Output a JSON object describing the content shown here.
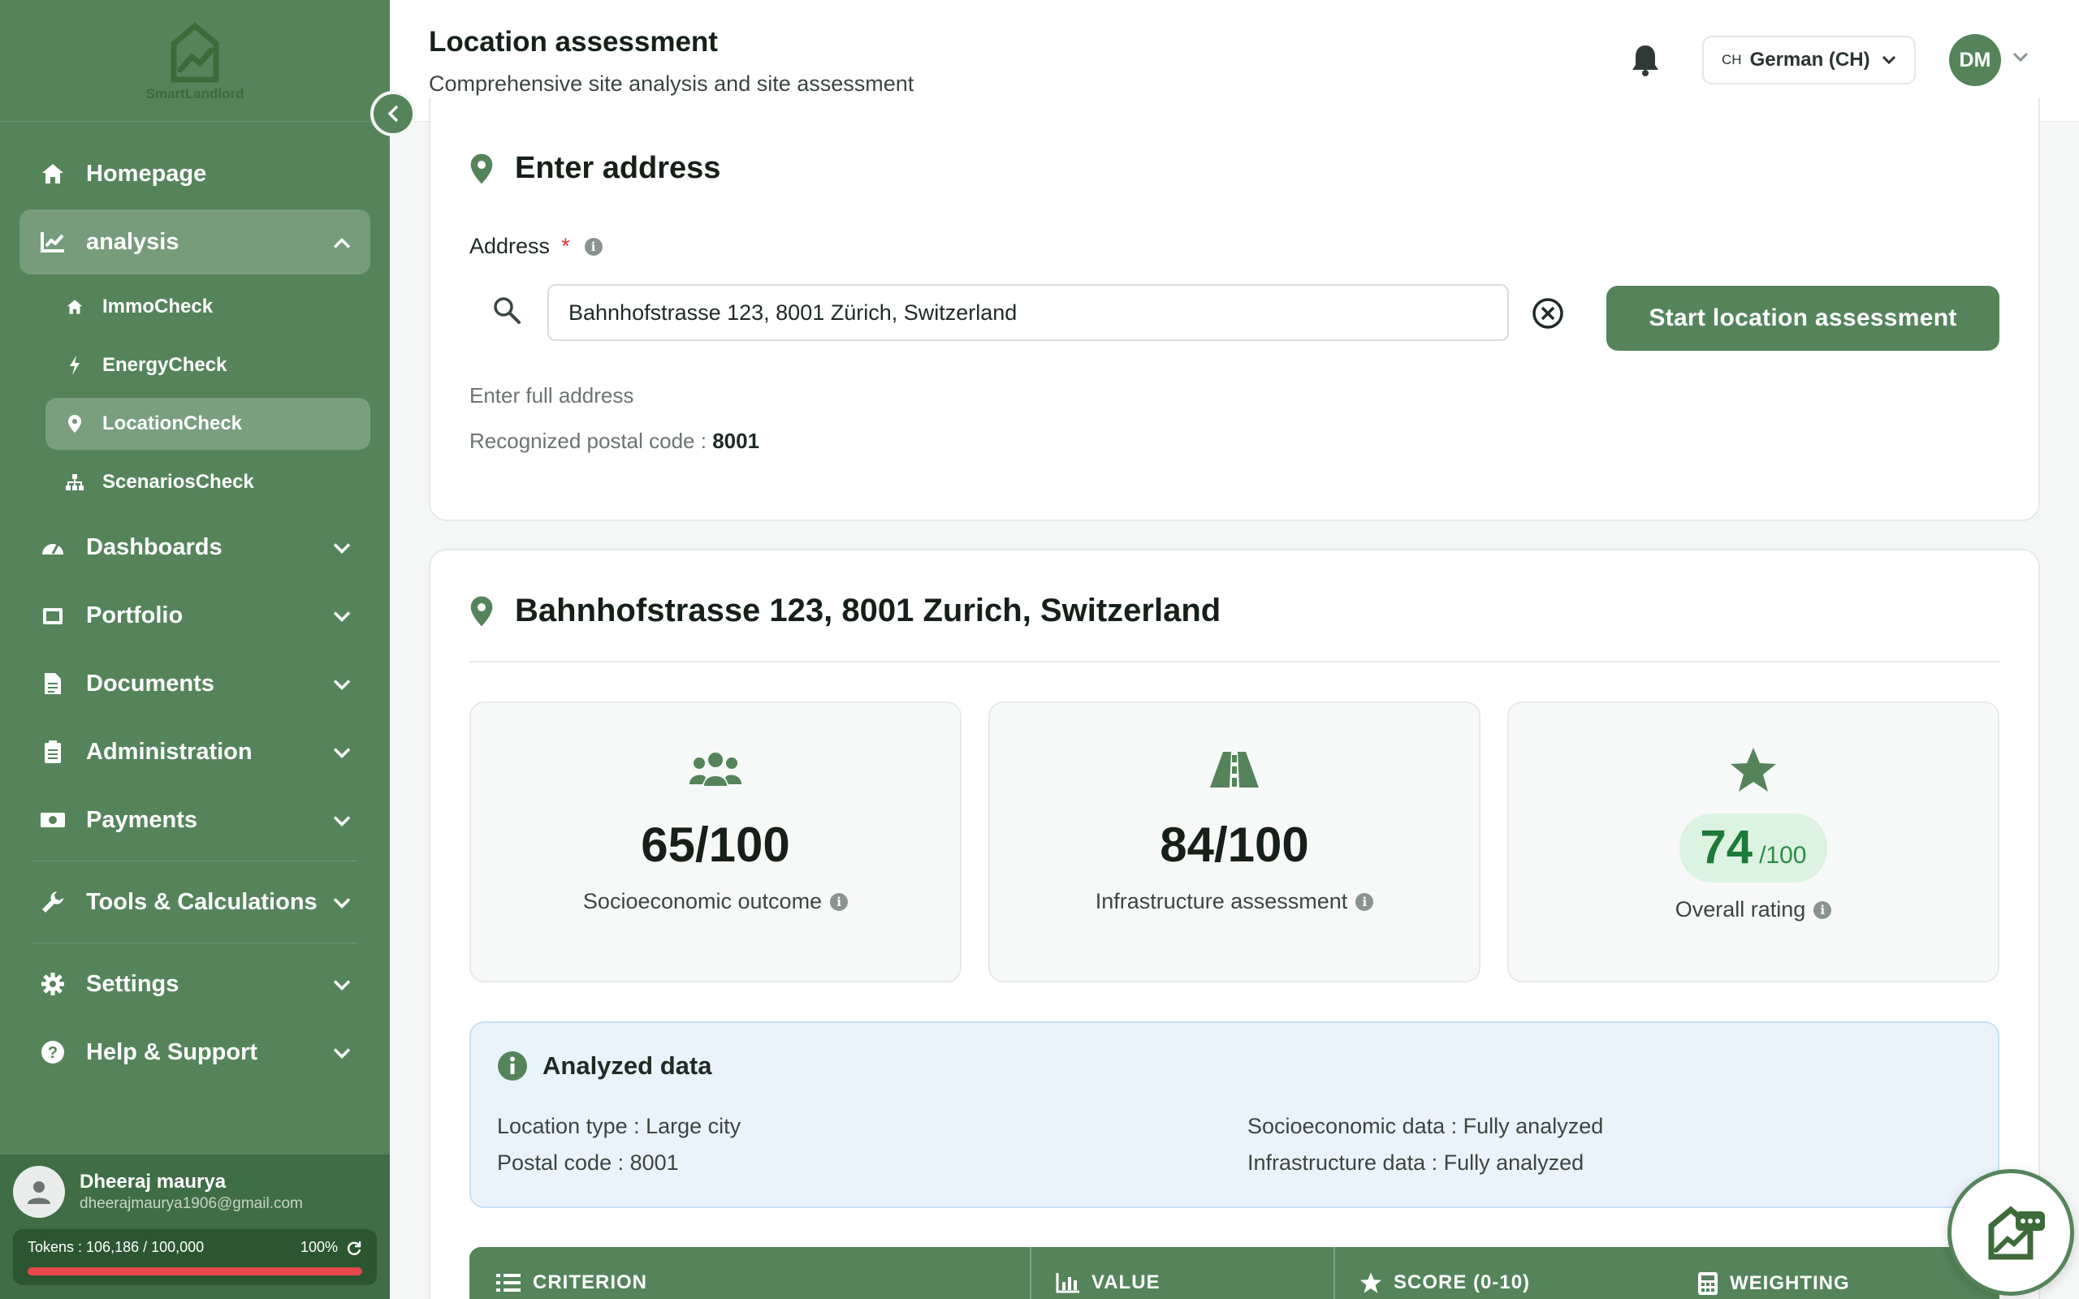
{
  "app": {
    "logo_text": "SmartLandlord"
  },
  "sidebar": {
    "nav": [
      {
        "label": "Homepage",
        "icon": "home-icon"
      },
      {
        "label": "analysis",
        "icon": "chart-line-icon",
        "expanded": true
      },
      {
        "label": "Dashboards",
        "icon": "gauge-icon"
      },
      {
        "label": "Portfolio",
        "icon": "portfolio-icon"
      },
      {
        "label": "Documents",
        "icon": "document-icon"
      },
      {
        "label": "Administration",
        "icon": "clipboard-icon"
      },
      {
        "label": "Payments",
        "icon": "money-icon"
      },
      {
        "label": "Tools & Calculations",
        "icon": "wrench-icon"
      },
      {
        "label": "Settings",
        "icon": "gear-icon"
      },
      {
        "label": "Help & Support",
        "icon": "help-icon"
      }
    ],
    "sub": [
      {
        "label": "ImmoCheck",
        "icon": "home-icon"
      },
      {
        "label": "EnergyCheck",
        "icon": "bolt-icon"
      },
      {
        "label": "LocationCheck",
        "icon": "pin-icon",
        "active": true
      },
      {
        "label": "ScenariosCheck",
        "icon": "hierarchy-icon"
      }
    ],
    "user": {
      "name": "Dheeraj maurya",
      "email": "dheerajmaurya1906@gmail.com"
    },
    "tokens": {
      "label": "Tokens : 106,186 / 100,000",
      "percent": "100%",
      "fill": 1.0
    }
  },
  "header": {
    "title": "Location assessment",
    "subtitle": "Comprehensive site analysis and site assessment",
    "lang_flag": "CH",
    "lang_label": "German (CH)",
    "avatar_initials": "DM"
  },
  "address_card": {
    "title": "Enter address",
    "field_label": "Address",
    "required_mark": "*",
    "input_value": "Bahnhofstrasse 123, 8001 Zürich, Switzerland",
    "start_button": "Start location assessment",
    "hint": "Enter full address",
    "postal_label": "Recognized postal code :",
    "postal_value": "8001"
  },
  "results": {
    "title": "Bahnhofstrasse 123, 8001 Zurich, Switzerland",
    "metrics": [
      {
        "value": "65/100",
        "caption": "Socioeconomic outcome",
        "icon": "users-icon"
      },
      {
        "value": "84/100",
        "caption": "Infrastructure assessment",
        "icon": "road-icon"
      },
      {
        "value": "74",
        "suffix": "/100",
        "caption": "Overall rating",
        "icon": "star-icon"
      }
    ],
    "analyzed": {
      "title": "Analyzed data",
      "location_type": "Location type : Large city",
      "postal_code": "Postal code : 8001",
      "socio": "Socioeconomic data : Fully analyzed",
      "infra": "Infrastructure data : Fully analyzed"
    },
    "table_headers": [
      "CRITERION",
      "VALUE",
      "SCORE (0-10)",
      "WEIGHTING"
    ]
  },
  "colors": {
    "brand": "#55845b",
    "brand_dark": "#3f6d45",
    "score_green": "#1e7a3a",
    "token_bar": "#e34848"
  }
}
